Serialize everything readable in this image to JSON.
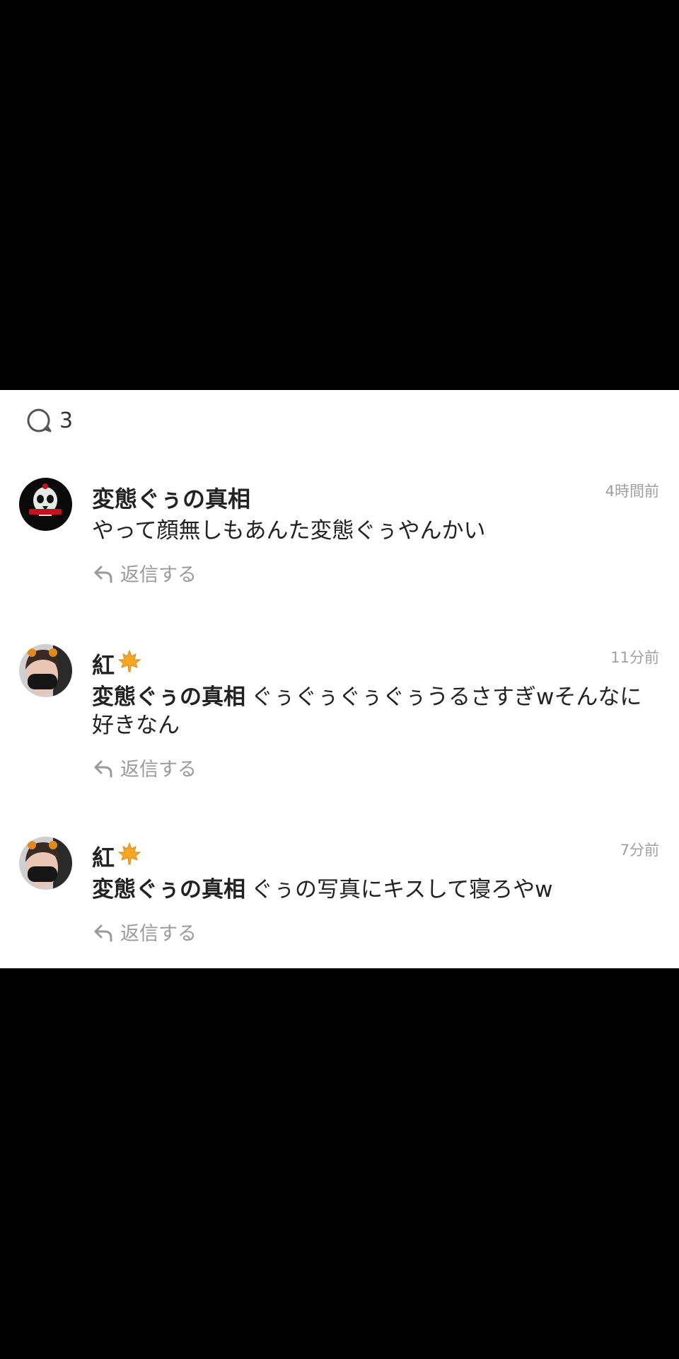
{
  "comments_count": "3",
  "comments": [
    {
      "username": "変態ぐぅの真相",
      "time": "4時間前",
      "mention": "",
      "text": "やって顔無しもあんた変態ぐぅやんかい",
      "reply_label": "返信する",
      "avatar_style": "skull-logo"
    },
    {
      "username": "紅",
      "time": "11分前",
      "mention": "変態ぐぅの真相",
      "text": "ぐぅぐぅぐぅぐぅうるさすぎwそんなに好きなん",
      "reply_label": "返信する",
      "avatar_style": "photo-person-mask"
    },
    {
      "username": "紅",
      "time": "7分前",
      "mention": "変態ぐぅの真相",
      "text": "ぐぅの写真にキスして寝ろやw",
      "reply_label": "返信する",
      "avatar_style": "photo-person-mask"
    }
  ],
  "colors": {
    "background": "#ffffff",
    "outer": "#000000",
    "text": "#222222",
    "muted": "#9a9a9a",
    "leaf": "#f5a623"
  },
  "icons": {
    "comment": "comment-bubble-icon",
    "reply": "reply-arrow-icon",
    "leaf": "maple-leaf-icon"
  }
}
